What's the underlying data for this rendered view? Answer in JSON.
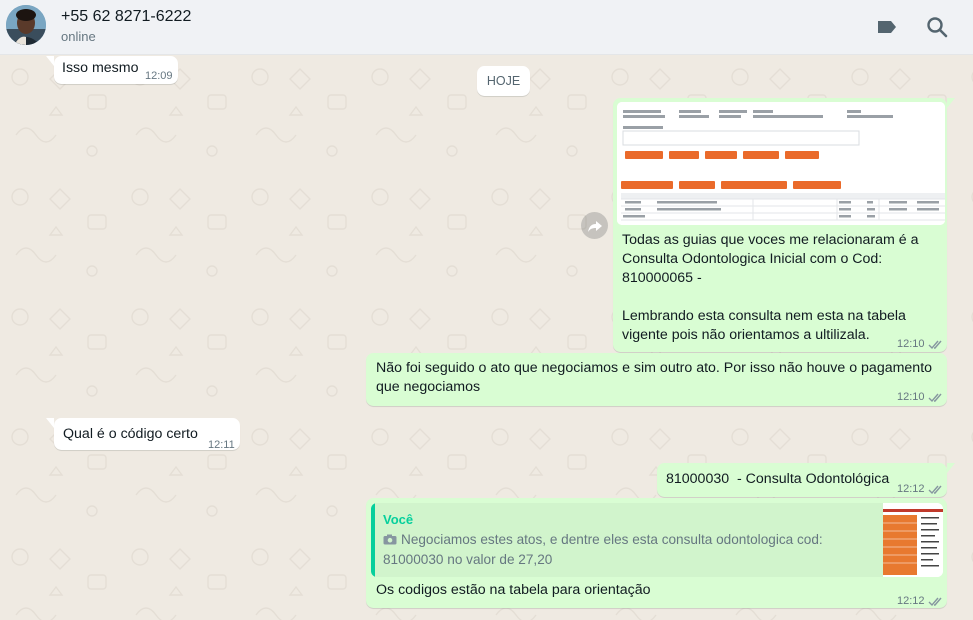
{
  "header": {
    "contact_name": "+55 62 8271-6222",
    "status": "online",
    "icons": [
      "label-icon",
      "search-icon"
    ]
  },
  "chat": {
    "date_chip": "HOJE",
    "messages": [
      {
        "direction": "incoming",
        "text": "Isso mesmo",
        "time": "12:09"
      },
      {
        "direction": "outgoing",
        "has_image": true,
        "text": "Todas as guias que voces me relacionaram é a Consulta Odontologica Inicial com o Cod: 810000065 -\n\nLembrando esta consulta nem esta na tabela vigente pois não orientamos a ultilizala.",
        "time": "12:10",
        "status": "read"
      },
      {
        "direction": "outgoing",
        "text": "Não foi seguido o ato que negociamos e sim outro ato. Por isso não houve o pagamento que negociamos",
        "time": "12:10",
        "status": "read"
      },
      {
        "direction": "incoming",
        "text": "Qual é o código certo",
        "time": "12:11"
      },
      {
        "direction": "outgoing",
        "text": "81000030  - Consulta Odontológica",
        "time": "12:12",
        "status": "read"
      },
      {
        "direction": "outgoing",
        "quote": {
          "author": "Você",
          "text": "Negociamos estes atos, e dentre eles esta consulta odontologica cod: 81000030 no valor de 27,20",
          "icon": "camera-icon"
        },
        "text": "Os codigos estão na tabela para orientação",
        "time": "12:12",
        "status": "read"
      }
    ]
  },
  "colors": {
    "header_bg": "#f0f2f5",
    "chat_bg": "#efeae2",
    "outgoing_bubble": "#d9fdd3",
    "incoming_bubble": "#ffffff",
    "read_ticks": "#8696a0",
    "quote_accent": "#06cf9c"
  }
}
